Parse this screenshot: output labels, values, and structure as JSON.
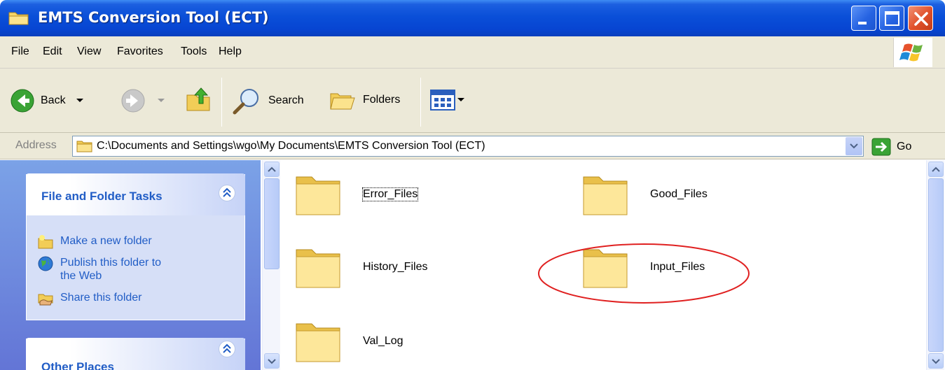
{
  "window": {
    "title": "EMTS Conversion Tool (ECT)"
  },
  "menu": [
    "File",
    "Edit",
    "View",
    "Favorites",
    "Tools",
    "Help"
  ],
  "toolbar": {
    "back": "Back",
    "search": "Search",
    "folders": "Folders"
  },
  "address": {
    "label": "Address",
    "path": "C:\\Documents and Settings\\wgo\\My Documents\\EMTS Conversion Tool (ECT)",
    "go": "Go"
  },
  "tasks": {
    "header": "File and Folder Tasks",
    "items": [
      {
        "line1": "Make a new folder",
        "line2": ""
      },
      {
        "line1": "Publish this folder to",
        "line2": "the Web"
      },
      {
        "line1": "Share this folder",
        "line2": ""
      }
    ]
  },
  "other_places": {
    "header": "Other Places"
  },
  "folders": [
    "Error_Files",
    "Good_Files",
    "History_Files",
    "Input_Files",
    "Val_Log"
  ],
  "colors": {
    "title_blue": "#0a4fd8",
    "task_link": "#215dc6",
    "highlight": "#e02020"
  }
}
